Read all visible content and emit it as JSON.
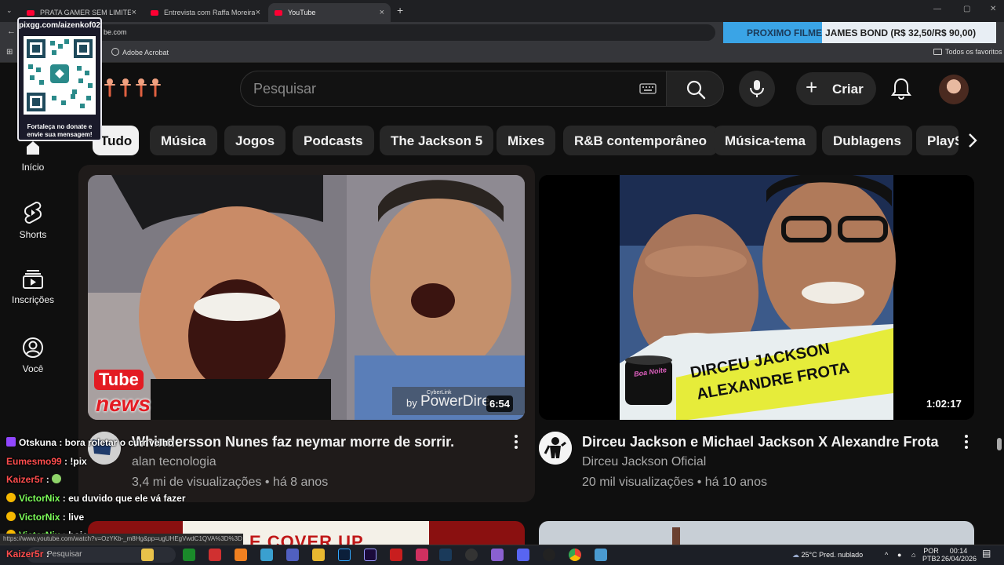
{
  "browser": {
    "tabs": [
      {
        "label": "PRATA GAMER SEM LIMITES - Y",
        "active": false
      },
      {
        "label": "Entrevista com Raffa Moreira - ",
        "active": false
      },
      {
        "label": "YouTube",
        "active": true
      }
    ],
    "url_fragment": "be.com",
    "bookmarks": {
      "acrobat": "Adobe Acrobat",
      "favorites": "Todos os favoritos"
    },
    "status_url": "https://www.youtube.com/watch?v=OzYKb-_m8Hg&pp=ugUHEgVwdC1QVA%3D%3D"
  },
  "overlay": {
    "movie_label": "PROXIMO FILME",
    "movie_value": "JAMES BOND (R$ 32,50/R$ 90,00)",
    "donate_url": "pixgg.com/aizenkof02",
    "donate_message": "Fortaleça no donate e envie sua mensagem!",
    "chat": [
      {
        "user": "Otskuna",
        "message": " : bora roletar o curr velho",
        "color": "#ffffff",
        "icon": "twitch-icon"
      },
      {
        "user": "Eumesmo99",
        "message": " : !pix",
        "color": "#ff4d4d",
        "icon": ""
      },
      {
        "user": "Kaizer5r",
        "message": " : ",
        "color": "#ff4d4d",
        "icon": ""
      },
      {
        "user": "VictorNix",
        "message": " : eu duvido que ele vá fazer",
        "color": "#7dff5a",
        "icon": "warn-icon"
      },
      {
        "user": "VictorNix",
        "message": " : live",
        "color": "#7dff5a",
        "icon": "warn-icon"
      },
      {
        "user": "VictorNix",
        "message": " : hoje",
        "color": "#7dff5a",
        "icon": "warn-icon"
      },
      {
        "user": "Kaizer5r",
        "message": " : ",
        "color": "#ff4d4d",
        "icon": ""
      }
    ]
  },
  "youtube": {
    "search_placeholder": "Pesquisar",
    "create_label": "Criar",
    "chips": [
      "Tudo",
      "Música",
      "Jogos",
      "Podcasts",
      "The Jackson 5",
      "Mixes",
      "R&B contemporâneo",
      "Música-tema",
      "Dublagens",
      "PlayS"
    ],
    "sidebar": [
      {
        "label": "Início",
        "icon": "home-icon"
      },
      {
        "label": "Shorts",
        "icon": "shorts-icon"
      },
      {
        "label": "Inscrições",
        "icon": "subscriptions-icon"
      },
      {
        "label": "Você",
        "icon": "you-icon"
      }
    ],
    "videos": [
      {
        "title": "Whindersson Nunes faz neymar morre de sorrir.",
        "channel": "alan tecnologia",
        "views": "3,4 mi de visualizações",
        "age": "há 8 anos",
        "duration": "6:54",
        "thumb_text_1": "Tube",
        "thumb_text_2": "news",
        "watermark_small": "CyberLink",
        "watermark_prefix": "by",
        "watermark": "PowerDire"
      },
      {
        "title": "Dirceu Jackson e Michael Jackson X Alexandre Frota",
        "channel": "Dirceu Jackson Oficial",
        "views": "20 mil visualizações",
        "age": "há 10 anos",
        "duration": "1:02:17",
        "thumb_text_1": "DIRCEU JACKSON",
        "thumb_text_2": "ALEXANDRE FROTA",
        "mug_text": "Boa Noite"
      }
    ],
    "peek_text": "E COVER UP"
  },
  "taskbar": {
    "search_label": "Pesquisar",
    "weather": "25°C  Pred. nublado",
    "lang": "POR",
    "layout": "PTB2",
    "time": "00:14",
    "date": "26/04/2026"
  },
  "colors": {
    "yt_red": "#ff0033",
    "banner_blue": "#3aa4e6",
    "chip_selected": "#f1f1f1"
  }
}
